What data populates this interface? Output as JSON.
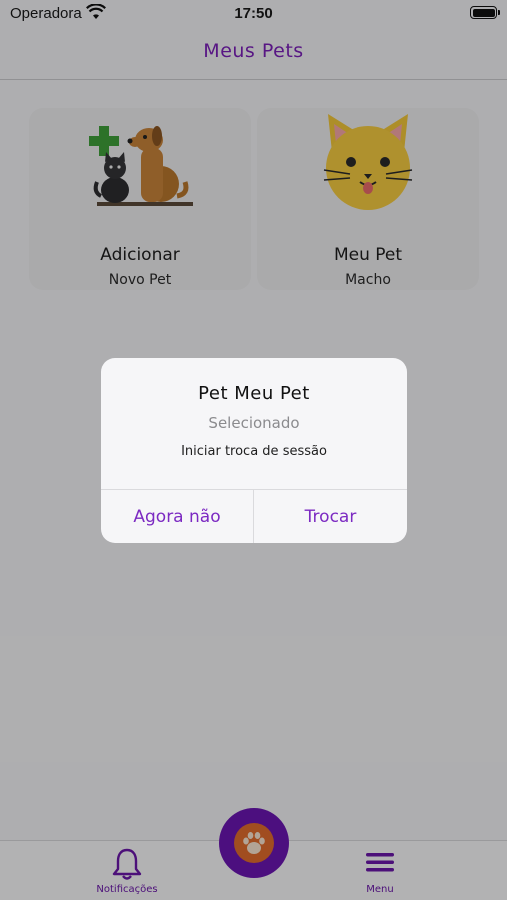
{
  "status_bar": {
    "carrier": "Operadora",
    "time": "17:50"
  },
  "nav": {
    "title": "Meus Pets"
  },
  "cards": [
    {
      "title": "Adicionar",
      "subtitle": "Novo Pet"
    },
    {
      "title": "Meu Pet",
      "subtitle": "Macho"
    }
  ],
  "alert": {
    "title": "Pet Meu Pet",
    "subtitle": "Selecionado",
    "message": "Iniciar troca de sessão",
    "cancel_label": "Agora não",
    "confirm_label": "Trocar"
  },
  "tab_bar": {
    "notifications_label": "Notificações",
    "menu_label": "Menu"
  },
  "colors": {
    "accent": "#7a1fb8",
    "fab": "#6a16b0",
    "paw_bg": "#e06b2d"
  }
}
